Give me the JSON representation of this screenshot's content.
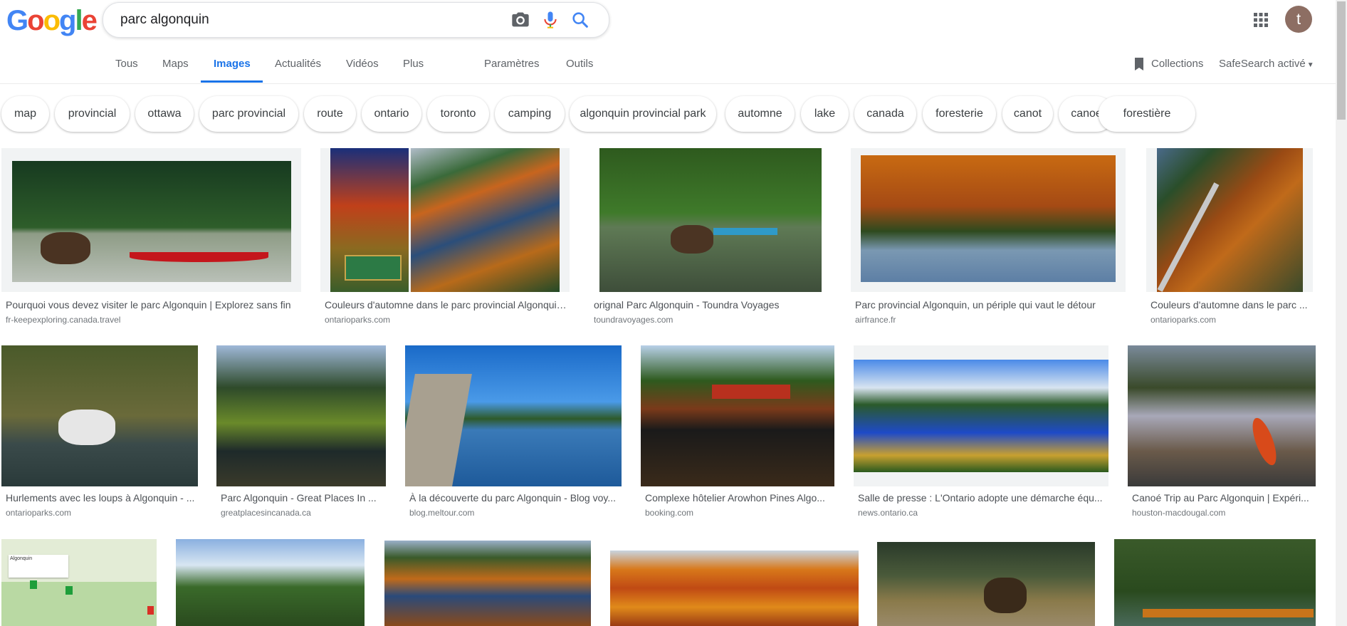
{
  "header": {
    "logo_letters": [
      {
        "ch": "G",
        "color": "#4285F4"
      },
      {
        "ch": "o",
        "color": "#EA4335"
      },
      {
        "ch": "o",
        "color": "#FBBC05"
      },
      {
        "ch": "g",
        "color": "#4285F4"
      },
      {
        "ch": "l",
        "color": "#34A853"
      },
      {
        "ch": "e",
        "color": "#EA4335"
      }
    ],
    "search_query": "parc algonquin",
    "avatar_letter": "t"
  },
  "tabs": {
    "all": "Tous",
    "maps": "Maps",
    "images": "Images",
    "news": "Actualités",
    "videos": "Vidéos",
    "more": "Plus",
    "settings": "Paramètres",
    "tools": "Outils",
    "collections": "Collections",
    "safesearch": "SafeSearch activé"
  },
  "chips": [
    "map",
    "provincial",
    "ottawa",
    "parc provincial",
    "route",
    "ontario",
    "toronto",
    "camping",
    "algonquin provincial park",
    "automne",
    "lake",
    "canada",
    "foresterie",
    "canot",
    "canoe",
    "forestière"
  ],
  "results": [
    {
      "title": "Pourquoi vous devez visiter le parc Algonquin | Explorez sans fin",
      "source": "fr-keepexploring.canada.travel"
    },
    {
      "title": "Couleurs d'automne dans le parc provincial Algonquin ...",
      "source": "ontarioparks.com"
    },
    {
      "title": "orignal Parc Algonquin - Toundra Voyages",
      "source": "toundravoyages.com"
    },
    {
      "title": "Parc provincial Algonquin, un périple qui vaut le détour",
      "source": "airfrance.fr"
    },
    {
      "title": "Couleurs d'automne dans le parc ...",
      "source": "ontarioparks.com"
    },
    {
      "title": "Hurlements avec les loups à Algonquin - ...",
      "source": "ontarioparks.com"
    },
    {
      "title": "Parc Algonquin - Great Places In ...",
      "source": "greatplacesincanada.ca"
    },
    {
      "title": "À la découverte du parc Algonquin - Blog voy...",
      "source": "blog.meltour.com"
    },
    {
      "title": "Complexe hôtelier Arowhon Pines Algo...",
      "source": "booking.com"
    },
    {
      "title": "Salle de presse : L'Ontario adopte une démarche équ...",
      "source": "news.ontario.ca"
    },
    {
      "title": "Canoé Trip au Parc Algonquin | Expéri...",
      "source": "houston-macdougal.com"
    }
  ],
  "map_card": {
    "label": "Algonquin"
  },
  "colors": {
    "accent": "#1a73e8"
  }
}
